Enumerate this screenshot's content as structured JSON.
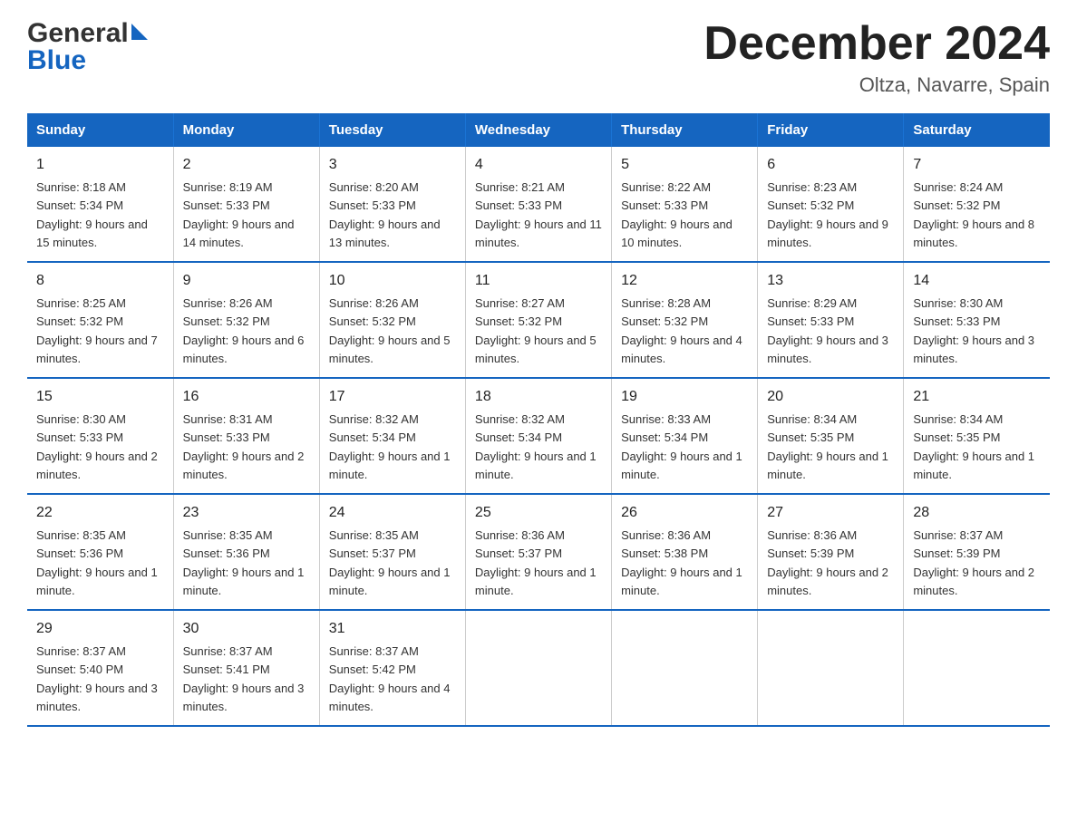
{
  "header": {
    "logo_top": "General",
    "logo_bottom": "Blue",
    "main_title": "December 2024",
    "subtitle": "Oltza, Navarre, Spain"
  },
  "days_of_week": [
    "Sunday",
    "Monday",
    "Tuesday",
    "Wednesday",
    "Thursday",
    "Friday",
    "Saturday"
  ],
  "weeks": [
    [
      {
        "day": "1",
        "sunrise": "8:18 AM",
        "sunset": "5:34 PM",
        "daylight": "9 hours and 15 minutes."
      },
      {
        "day": "2",
        "sunrise": "8:19 AM",
        "sunset": "5:33 PM",
        "daylight": "9 hours and 14 minutes."
      },
      {
        "day": "3",
        "sunrise": "8:20 AM",
        "sunset": "5:33 PM",
        "daylight": "9 hours and 13 minutes."
      },
      {
        "day": "4",
        "sunrise": "8:21 AM",
        "sunset": "5:33 PM",
        "daylight": "9 hours and 11 minutes."
      },
      {
        "day": "5",
        "sunrise": "8:22 AM",
        "sunset": "5:33 PM",
        "daylight": "9 hours and 10 minutes."
      },
      {
        "day": "6",
        "sunrise": "8:23 AM",
        "sunset": "5:32 PM",
        "daylight": "9 hours and 9 minutes."
      },
      {
        "day": "7",
        "sunrise": "8:24 AM",
        "sunset": "5:32 PM",
        "daylight": "9 hours and 8 minutes."
      }
    ],
    [
      {
        "day": "8",
        "sunrise": "8:25 AM",
        "sunset": "5:32 PM",
        "daylight": "9 hours and 7 minutes."
      },
      {
        "day": "9",
        "sunrise": "8:26 AM",
        "sunset": "5:32 PM",
        "daylight": "9 hours and 6 minutes."
      },
      {
        "day": "10",
        "sunrise": "8:26 AM",
        "sunset": "5:32 PM",
        "daylight": "9 hours and 5 minutes."
      },
      {
        "day": "11",
        "sunrise": "8:27 AM",
        "sunset": "5:32 PM",
        "daylight": "9 hours and 5 minutes."
      },
      {
        "day": "12",
        "sunrise": "8:28 AM",
        "sunset": "5:32 PM",
        "daylight": "9 hours and 4 minutes."
      },
      {
        "day": "13",
        "sunrise": "8:29 AM",
        "sunset": "5:33 PM",
        "daylight": "9 hours and 3 minutes."
      },
      {
        "day": "14",
        "sunrise": "8:30 AM",
        "sunset": "5:33 PM",
        "daylight": "9 hours and 3 minutes."
      }
    ],
    [
      {
        "day": "15",
        "sunrise": "8:30 AM",
        "sunset": "5:33 PM",
        "daylight": "9 hours and 2 minutes."
      },
      {
        "day": "16",
        "sunrise": "8:31 AM",
        "sunset": "5:33 PM",
        "daylight": "9 hours and 2 minutes."
      },
      {
        "day": "17",
        "sunrise": "8:32 AM",
        "sunset": "5:34 PM",
        "daylight": "9 hours and 1 minute."
      },
      {
        "day": "18",
        "sunrise": "8:32 AM",
        "sunset": "5:34 PM",
        "daylight": "9 hours and 1 minute."
      },
      {
        "day": "19",
        "sunrise": "8:33 AM",
        "sunset": "5:34 PM",
        "daylight": "9 hours and 1 minute."
      },
      {
        "day": "20",
        "sunrise": "8:34 AM",
        "sunset": "5:35 PM",
        "daylight": "9 hours and 1 minute."
      },
      {
        "day": "21",
        "sunrise": "8:34 AM",
        "sunset": "5:35 PM",
        "daylight": "9 hours and 1 minute."
      }
    ],
    [
      {
        "day": "22",
        "sunrise": "8:35 AM",
        "sunset": "5:36 PM",
        "daylight": "9 hours and 1 minute."
      },
      {
        "day": "23",
        "sunrise": "8:35 AM",
        "sunset": "5:36 PM",
        "daylight": "9 hours and 1 minute."
      },
      {
        "day": "24",
        "sunrise": "8:35 AM",
        "sunset": "5:37 PM",
        "daylight": "9 hours and 1 minute."
      },
      {
        "day": "25",
        "sunrise": "8:36 AM",
        "sunset": "5:37 PM",
        "daylight": "9 hours and 1 minute."
      },
      {
        "day": "26",
        "sunrise": "8:36 AM",
        "sunset": "5:38 PM",
        "daylight": "9 hours and 1 minute."
      },
      {
        "day": "27",
        "sunrise": "8:36 AM",
        "sunset": "5:39 PM",
        "daylight": "9 hours and 2 minutes."
      },
      {
        "day": "28",
        "sunrise": "8:37 AM",
        "sunset": "5:39 PM",
        "daylight": "9 hours and 2 minutes."
      }
    ],
    [
      {
        "day": "29",
        "sunrise": "8:37 AM",
        "sunset": "5:40 PM",
        "daylight": "9 hours and 3 minutes."
      },
      {
        "day": "30",
        "sunrise": "8:37 AM",
        "sunset": "5:41 PM",
        "daylight": "9 hours and 3 minutes."
      },
      {
        "day": "31",
        "sunrise": "8:37 AM",
        "sunset": "5:42 PM",
        "daylight": "9 hours and 4 minutes."
      },
      null,
      null,
      null,
      null
    ]
  ],
  "labels": {
    "sunrise": "Sunrise:",
    "sunset": "Sunset:",
    "daylight": "Daylight:"
  }
}
